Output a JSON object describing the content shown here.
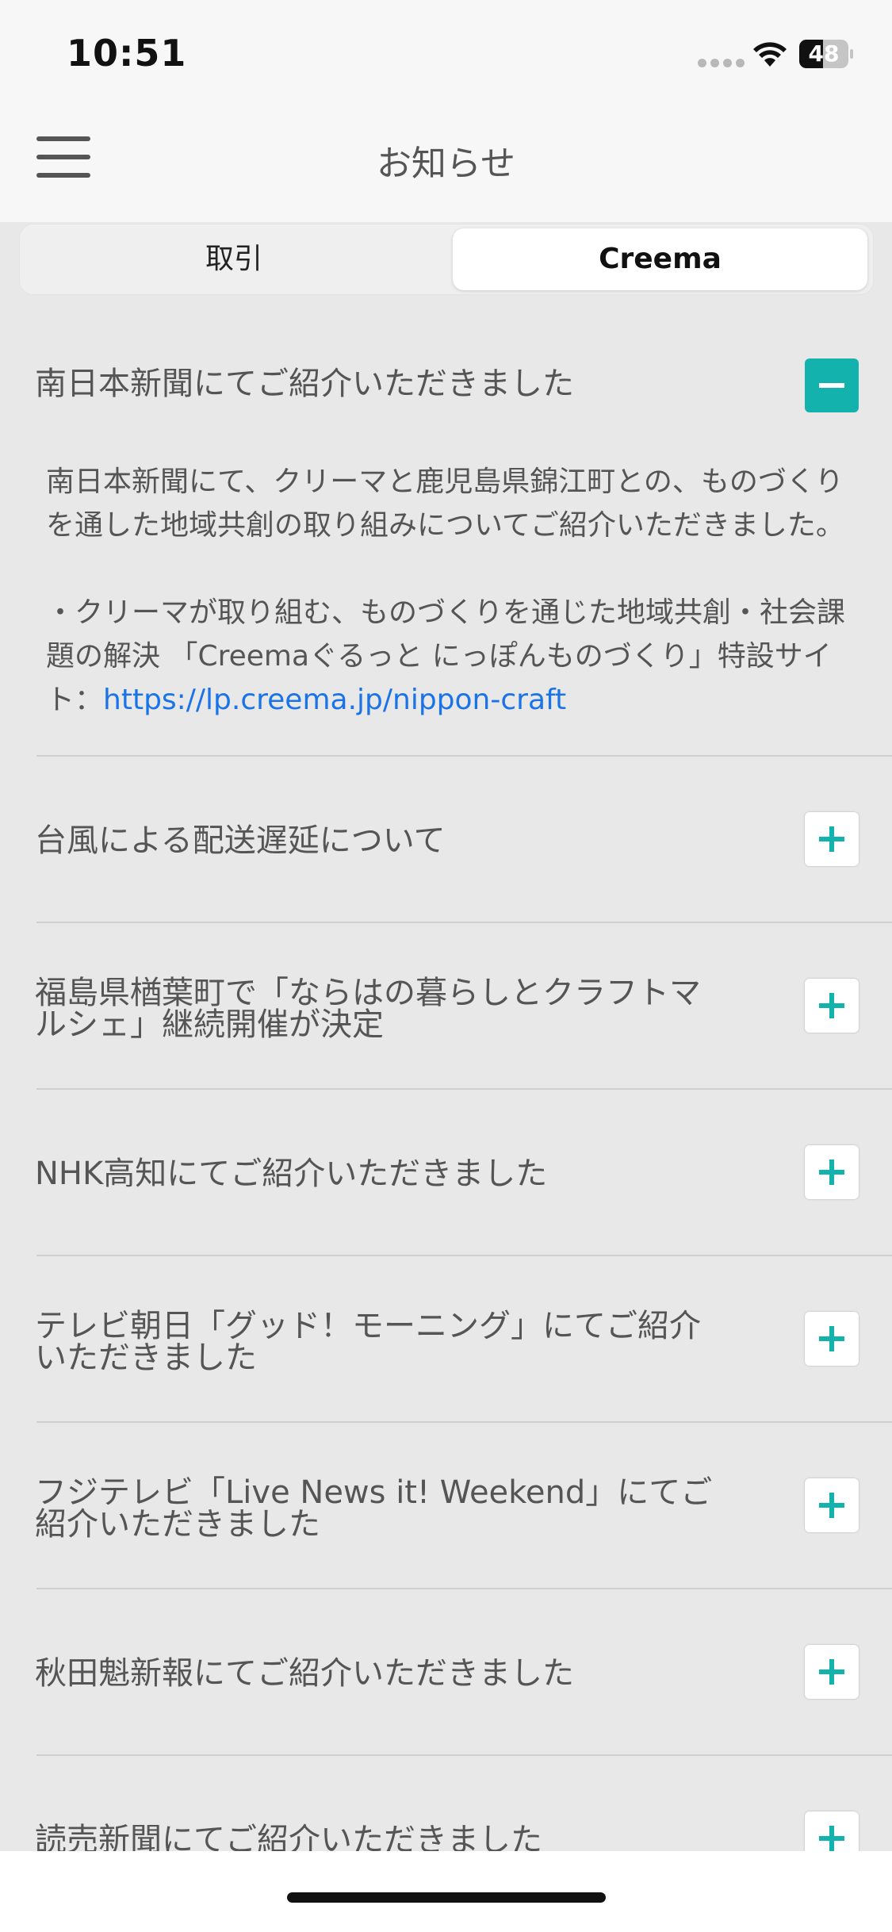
{
  "status_bar": {
    "time": "10:51",
    "battery": "48",
    "battery_level": 0.48
  },
  "nav": {
    "title": "お知らせ"
  },
  "tabs": [
    {
      "label": "取引",
      "active": false
    },
    {
      "label": "Creema",
      "active": true
    }
  ],
  "expanded_item": {
    "title": "南日本新聞にてご紹介いただきました",
    "body_line1": "南日本新聞にて、クリーマと鹿児島県錦江町との、ものづくり",
    "body_line2": "を通した地域共創の取り組みについてご紹介いただきました。",
    "body_line3": "・クリーマが取り組む、ものづくりを通じた地域共創・社会課",
    "body_line4": "題の解決 「Creemaぐるっと にっぽんものづくり」特設サイ",
    "body_line5_prefix": "ト：",
    "link": "https://lp.creema.jp/nippon-craft"
  },
  "items": [
    {
      "title_line1": "台風による配送遅延について",
      "title_line2": ""
    },
    {
      "title_line1": "福島県楢葉町で「ならはの暮らしとクラフトマ",
      "title_line2": "ルシェ」継続開催が決定"
    },
    {
      "title_line1": "NHK高知にてご紹介いただきました",
      "title_line2": ""
    },
    {
      "title_line1": "テレビ朝日「グッド！モーニング」にてご紹介",
      "title_line2": "いただきました"
    },
    {
      "title_line1": "フジテレビ「Live News it! Weekend」にてご",
      "title_line2": "紹介いただきました"
    },
    {
      "title_line1": "秋田魁新報にてご紹介いただきました",
      "title_line2": ""
    },
    {
      "title_line1": "読売新聞にてご紹介いただきました",
      "title_line2": ""
    }
  ],
  "colors": {
    "accent": "#14b2ad",
    "link": "#1a73e8",
    "background": "#e8e8e8"
  }
}
